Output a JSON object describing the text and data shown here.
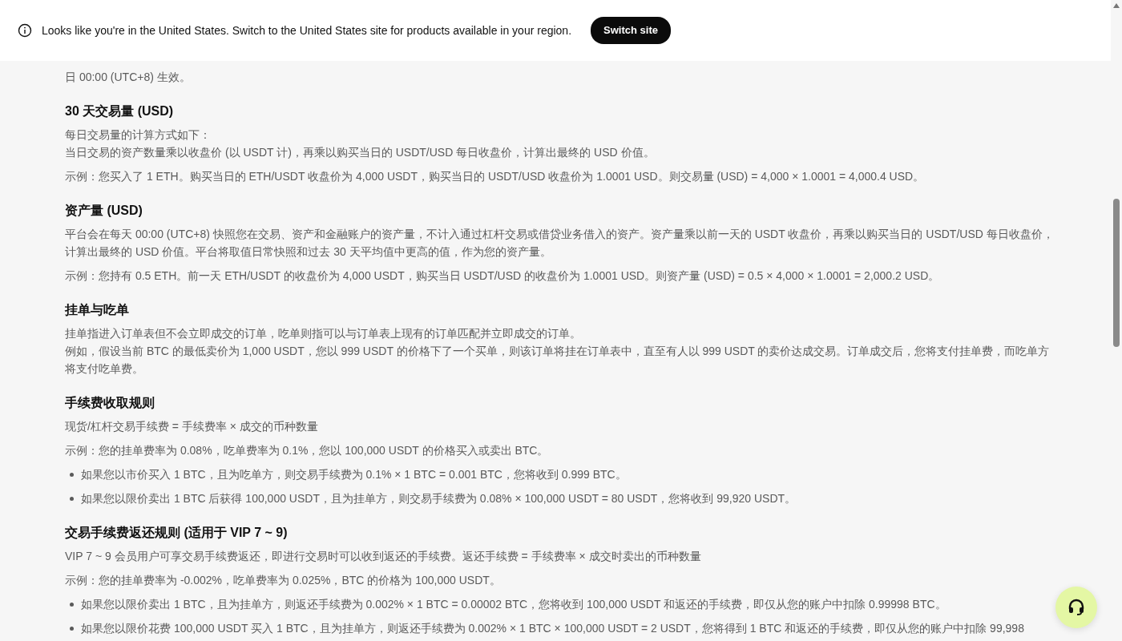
{
  "banner": {
    "message": "Looks like you're in the United States. Switch to the United States site for products available in your region.",
    "button": "Switch site"
  },
  "sections": [
    {
      "blocks": [
        {
          "kind": "para",
          "lines": [
            "日 00:00 (UTC+8) 生效。"
          ]
        }
      ]
    },
    {
      "title": "30 天交易量 (USD)",
      "blocks": [
        {
          "kind": "para",
          "lines": [
            "每日交易量的计算方式如下：",
            "当日交易的资产数量乘以收盘价 (以 USDT 计)，再乘以购买当日的 USDT/USD 每日收盘价，计算出最终的 USD 价值。"
          ]
        },
        {
          "kind": "para",
          "lines": [
            "示例：您买入了 1 ETH。购买当日的 ETH/USDT 收盘价为 4,000 USDT，购买当日的 USDT/USD 收盘价为 1.0001 USD。则交易量 (USD) = 4,000 × 1.0001 = 4,000.4 USD。"
          ]
        }
      ]
    },
    {
      "title": "资产量 (USD)",
      "blocks": [
        {
          "kind": "para",
          "lines": [
            "平台会在每天 00:00 (UTC+8) 快照您在交易、资产和金融账户的资产量，不计入通过杠杆交易或借贷业务借入的资产。资产量乘以前一天的 USDT 收盘价，再乘以购买当日的 USDT/USD 每日收盘价，计算出最终的 USD 价值。平台将取值日常快照和过去 30 天平均值中更高的值，作为您的资产量。"
          ]
        },
        {
          "kind": "para",
          "lines": [
            "示例：您持有 0.5 ETH。前一天 ETH/USDT 的收盘价为 4,000 USDT，购买当日 USDT/USD 的收盘价为 1.0001 USD。则资产量 (USD) = 0.5 × 4,000 × 1.0001 = 2,000.2 USD。"
          ]
        }
      ]
    },
    {
      "title": "挂单与吃单",
      "blocks": [
        {
          "kind": "para",
          "lines": [
            "挂单指进入订单表但不会立即成交的订单，吃单则指可以与订单表上现有的订单匹配并立即成交的订单。",
            "例如，假设当前 BTC 的最低卖价为 1,000 USDT，您以 999 USDT 的价格下了一个买单，则该订单将挂在订单表中，直至有人以 999 USDT 的卖价达成交易。订单成交后，您将支付挂单费，而吃单方将支付吃单费。"
          ]
        }
      ]
    },
    {
      "title": "手续费收取规则",
      "blocks": [
        {
          "kind": "para",
          "lines": [
            "现货/杠杆交易手续费 = 手续费率 × 成交的币种数量"
          ]
        },
        {
          "kind": "para",
          "lines": [
            "示例：您的挂单费率为 0.08%，吃单费率为 0.1%，您以 100,000 USDT 的价格买入或卖出 BTC。"
          ]
        },
        {
          "kind": "bullet",
          "text": "如果您以市价买入 1 BTC，且为吃单方，则交易手续费为 0.1% × 1 BTC = 0.001 BTC，您将收到 0.999 BTC。"
        },
        {
          "kind": "bullet",
          "text": "如果您以限价卖出 1 BTC 后获得 100,000 USDT，且为挂单方，则交易手续费为 0.08% × 100,000 USDT = 80 USDT，您将收到 99,920 USDT。"
        }
      ]
    },
    {
      "title": "交易手续费返还规则 (适用于 VIP 7 ~ 9)",
      "blocks": [
        {
          "kind": "para",
          "lines": [
            "VIP 7 ~ 9 会员用户可享交易手续费返还，即进行交易时可以收到返还的手续费。返还手续费 = 手续费率 × 成交时卖出的币种数量"
          ]
        },
        {
          "kind": "para",
          "lines": [
            "示例：您的挂单费率为 -0.002%，吃单费率为 0.025%，BTC 的价格为 100,000 USDT。"
          ]
        },
        {
          "kind": "bullet",
          "text": "如果您以限价卖出 1 BTC，且为挂单方，则返还手续费为 0.002% × 1 BTC = 0.00002 BTC，您将收到 100,000 USDT 和返还的手续费，即仅从您的账户中扣除 0.99998 BTC。"
        },
        {
          "kind": "bullet",
          "text": "如果您以限价花费 100,000 USDT 买入 1 BTC，且为挂单方，则返还手续费为 0.002% × 1 BTC × 100,000 USDT = 2 USDT，您将得到 1 BTC 和返还的手续费，即仅从您的账户中扣除 99,998"
        }
      ]
    }
  ]
}
